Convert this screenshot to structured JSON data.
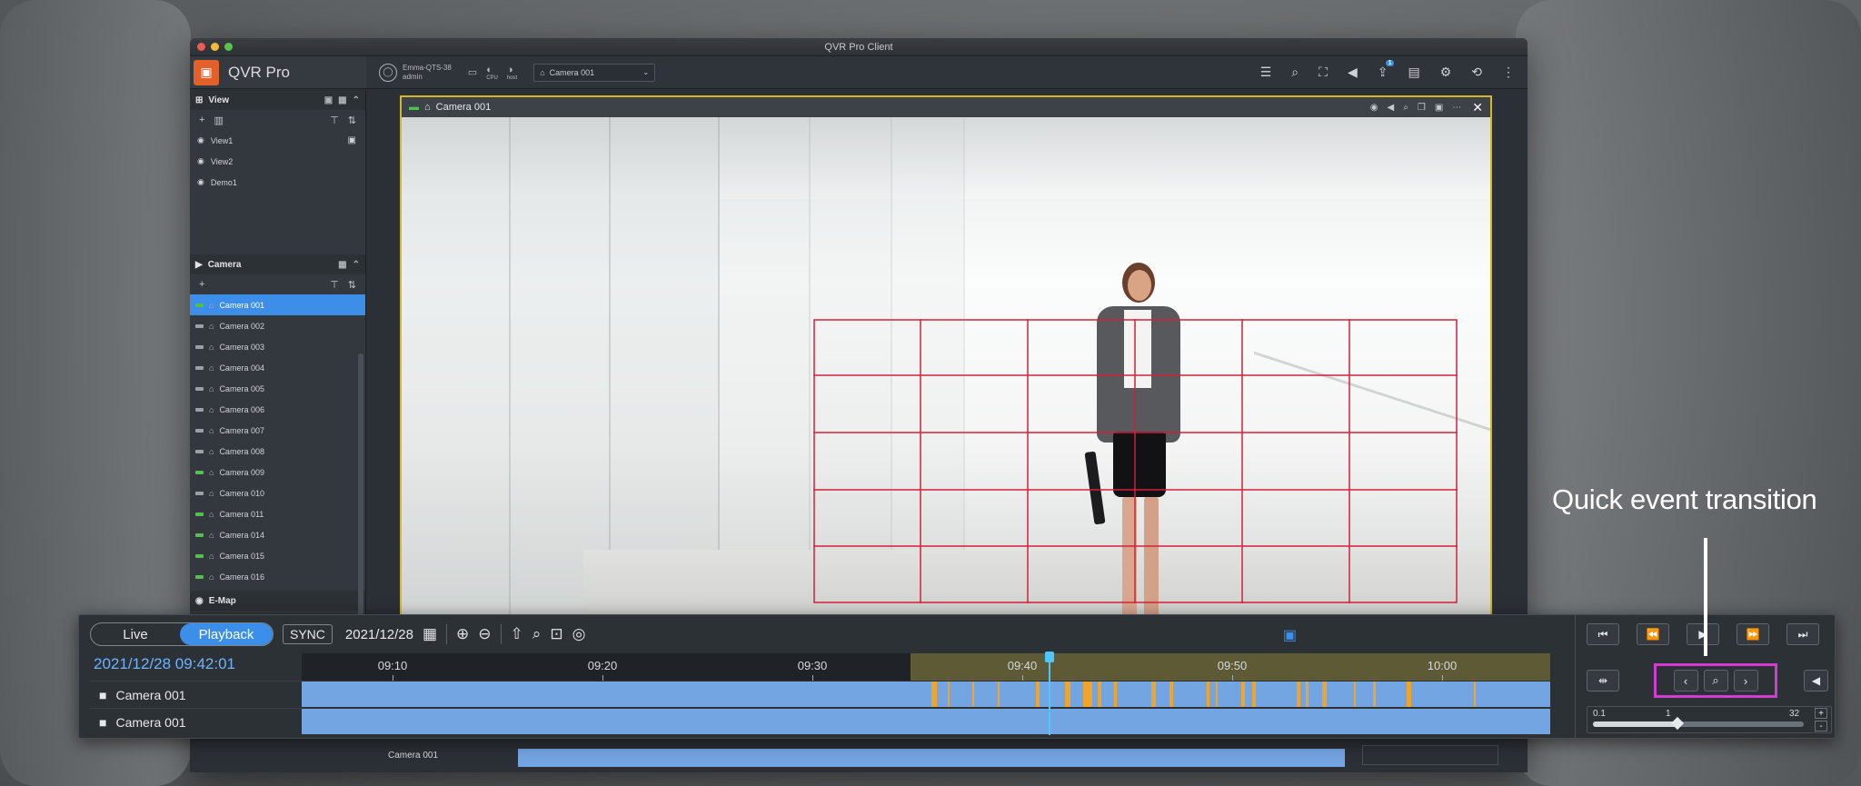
{
  "window": {
    "title": "QVR Pro Client"
  },
  "app": {
    "name": "QVR Pro"
  },
  "user": {
    "server": "Emma-QTS-38",
    "name": "admin"
  },
  "toolbar": {
    "cpu_label": "CPU",
    "host_label": "host",
    "camera_select": "Camera 001",
    "notif_count": "1"
  },
  "view_section": {
    "title": "View",
    "items": [
      "View1",
      "View2",
      "Demo1"
    ]
  },
  "camera_section": {
    "title": "Camera",
    "items": [
      {
        "label": "Camera 001",
        "recording": true,
        "selected": true
      },
      {
        "label": "Camera 002",
        "recording": false
      },
      {
        "label": "Camera 003",
        "recording": false
      },
      {
        "label": "Camera 004",
        "recording": false
      },
      {
        "label": "Camera 005",
        "recording": false
      },
      {
        "label": "Camera 006",
        "recording": false
      },
      {
        "label": "Camera 007",
        "recording": false
      },
      {
        "label": "Camera 008",
        "recording": false
      },
      {
        "label": "Camera 009",
        "recording": true
      },
      {
        "label": "Camera 010",
        "recording": false
      },
      {
        "label": "Camera 011",
        "recording": true
      },
      {
        "label": "Camera 014",
        "recording": true
      },
      {
        "label": "Camera 015",
        "recording": true
      },
      {
        "label": "Camera 016",
        "recording": true
      }
    ],
    "emap_label": "E-Map"
  },
  "video": {
    "channel_label": "Camera 001"
  },
  "timeline": {
    "mode_live": "Live",
    "mode_playback": "Playback",
    "sync_label": "SYNC",
    "date": "2021/12/28",
    "current_datetime": "2021/12/28 09:42:01",
    "ticks": [
      "09:10",
      "09:20",
      "09:30",
      "09:40",
      "09:50",
      "10:00"
    ],
    "tracks": [
      "Camera 001",
      "Camera 001"
    ],
    "ghost_track": "Camera 001"
  },
  "speed": {
    "min": "0.1",
    "mid": "1",
    "max": "32",
    "value": 1
  },
  "annotation": {
    "text": "Quick event transition"
  },
  "colors": {
    "accent": "#3b8fe8",
    "event": "#f0a52a",
    "highlight": "#d23cd2",
    "motion_grid": "#d3213a"
  }
}
